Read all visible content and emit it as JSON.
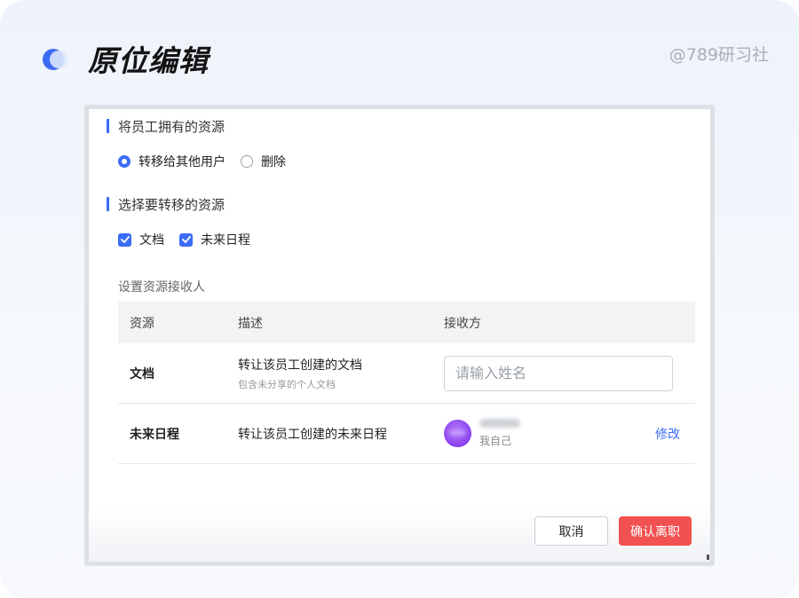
{
  "header": {
    "title": "原位编辑",
    "watermark": "@789研习社",
    "brand_color": "#3b6cf6"
  },
  "section_owned": {
    "title": "将员工拥有的资源",
    "options": [
      {
        "label": "转移给其他用户",
        "checked": true
      },
      {
        "label": "删除",
        "checked": false
      }
    ]
  },
  "section_select": {
    "title": "选择要转移的资源",
    "options": [
      {
        "label": "文档",
        "checked": true
      },
      {
        "label": "未来日程",
        "checked": true
      }
    ]
  },
  "recipient_section": {
    "label": "设置资源接收人",
    "columns": [
      "资源",
      "描述",
      "接收方"
    ],
    "rows": [
      {
        "resource": "文档",
        "desc": "转让该员工创建的文档",
        "desc_sub": "包含未分享的个人文档",
        "input_placeholder": "请输入姓名",
        "input_value": ""
      },
      {
        "resource": "未来日程",
        "desc": "转让该员工创建的未来日程",
        "recipient_sub": "我自己",
        "edit_label": "修改"
      }
    ]
  },
  "footer": {
    "cancel_label": "取消",
    "confirm_label": "确认离职",
    "confirm_color": "#f25151"
  }
}
